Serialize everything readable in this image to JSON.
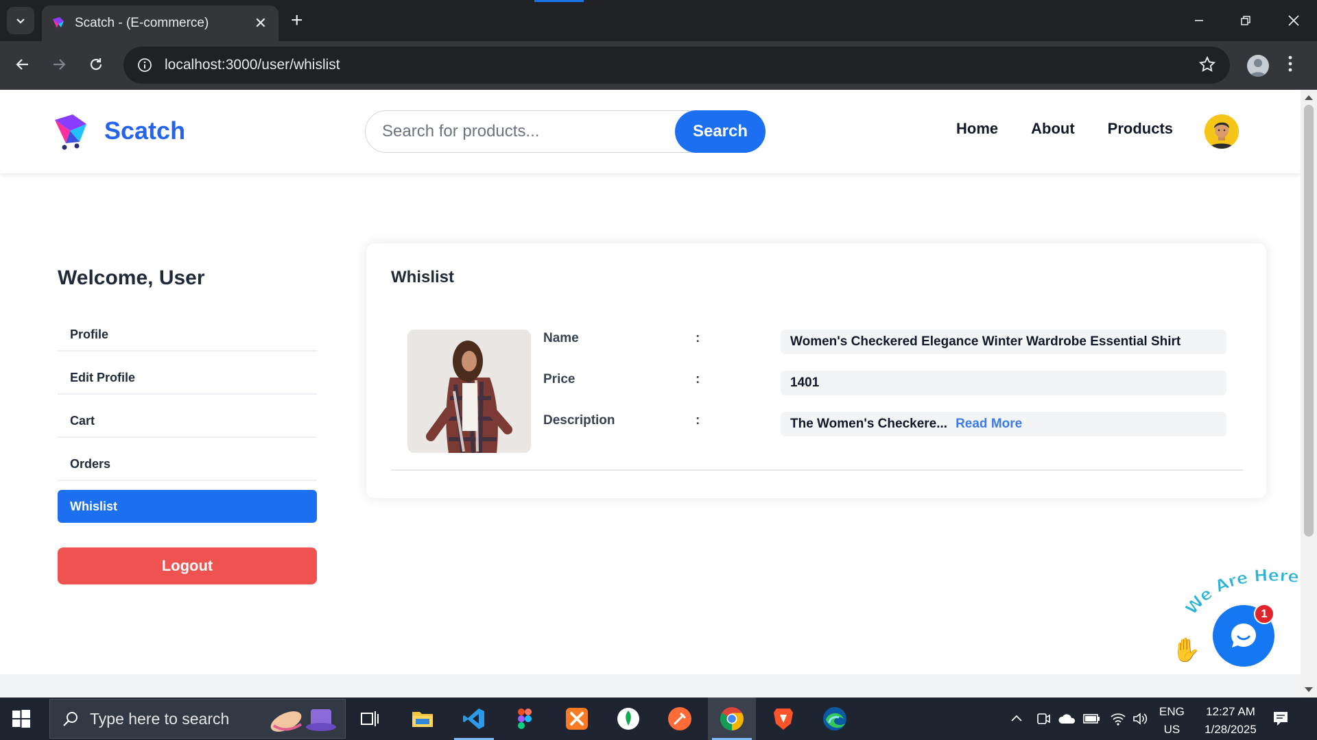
{
  "browser": {
    "tab_title": "Scatch - (E-commerce)",
    "url": "localhost:3000/user/whislist"
  },
  "site": {
    "brand": "Scatch",
    "search": {
      "placeholder": "Search for products...",
      "value": "",
      "button_label": "Search"
    },
    "nav": {
      "home": "Home",
      "about": "About",
      "products": "Products"
    }
  },
  "sidebar": {
    "welcome": "Welcome, User",
    "items": [
      {
        "label": "Profile",
        "active": false
      },
      {
        "label": "Edit Profile",
        "active": false
      },
      {
        "label": "Cart",
        "active": false
      },
      {
        "label": "Orders",
        "active": false
      },
      {
        "label": "Whislist",
        "active": true
      }
    ],
    "logout_label": "Logout"
  },
  "wishlist": {
    "title": "Whislist",
    "items": [
      {
        "name_label": "Name",
        "price_label": "Price",
        "description_label": "Description",
        "separator": ":",
        "name": "Women's Checkered Elegance Winter Wardrobe Essential Shirt",
        "price": "1401",
        "description": "The Women's Checkere...",
        "read_more": "Read More"
      }
    ]
  },
  "chat_widget": {
    "banner_text": "We Are Here!",
    "badge_count": "1"
  },
  "taskbar": {
    "search_placeholder": "Type here to search",
    "language_top": "ENG",
    "language_bottom": "US",
    "time": "12:27 AM",
    "date": "1/28/2025"
  },
  "colors": {
    "brand_blue": "#2563eb",
    "search_button": "#1d6ff2",
    "active_sidebar": "#1d6ff2",
    "logout_red": "#ef5350",
    "read_more": "#3b7be8",
    "chat_blue": "#1577f2",
    "badge_red": "#e0242c"
  },
  "icons": {
    "tab_search": "chevron-down-icon",
    "back": "arrow-left-icon",
    "forward": "arrow-right-icon",
    "reload": "reload-icon",
    "site_info": "info-icon",
    "bookmark": "star-icon",
    "menu": "kebab-icon",
    "chat": "chat-bubble-icon",
    "wave": "waving-hand-icon"
  }
}
